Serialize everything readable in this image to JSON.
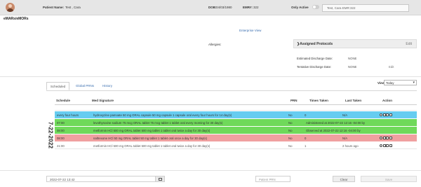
{
  "header": {
    "patient_label": "Patient Name:",
    "patient_name": "Test , Cara",
    "dob_label": "DOB:",
    "dob": "04/03/1980",
    "emr_label": "EMR#:",
    "emr": "322",
    "only_active_label": "Only Active",
    "patient_select_value": "Test, Cara EMR:322"
  },
  "module_title": "eMARs/eMORs",
  "enterprise_link": "Enterprise View",
  "allergies_label": "Allergies:",
  "protocols": {
    "title": "Assigned Protocols",
    "edit": "Edit"
  },
  "discharge": {
    "estimated_label": "Estimated Discharge Date:",
    "estimated_value": "NONE",
    "tentative_label": "Tentative Discharge Date:",
    "tentative_value": "NONE",
    "edit": "Edit"
  },
  "tabs": [
    "Scheduled",
    "Global PRNs",
    "History"
  ],
  "view": {
    "label": "View",
    "selected": "Today"
  },
  "table": {
    "headers": {
      "schedule": "Schedule",
      "med_signature": "Med Signature",
      "prn": "PRN",
      "times_taken": "Times Taken",
      "last_taken": "Last Taken",
      "action": "Action"
    },
    "date": "7-22-2022",
    "rows": [
      {
        "schedule": "every four hours",
        "med": "hydroxyzine pamoate 50 mg ORAL capsule 50 mg capsule 1 capsule oral every four hours for 14 day(s)",
        "prn": "No",
        "times_taken": "0",
        "last_taken": "N/A",
        "status": "blue"
      },
      {
        "schedule": "07:00",
        "med": "levothyroxine sodium 75 mcg ORAL tablet 75 mcg tablet 1 tablet oral every morning for 30 day(s)",
        "prn": "No",
        "times_taken": "Administered at 2022-07-22 12:16 -04:00 by",
        "last_taken": "",
        "status": "green"
      },
      {
        "schedule": "08:00",
        "med": "metformin HCl 500 mg ORAL tablet 500 mg tablet 1 tablet oral twice a day for 30 day(s)",
        "prn": "No",
        "times_taken": "Observed at 2022-07-22 12:16 -04:00 by",
        "last_taken": "",
        "status": "green"
      },
      {
        "schedule": "08:00",
        "med": "naltrexone HCl 50 mg ORAL tablet 50 mg tablet 1 tablet oral once a day for 30 day(s)",
        "prn": "No",
        "times_taken": "0",
        "last_taken": "N/A",
        "status": "red"
      },
      {
        "schedule": "21:00",
        "med": "metformin HCl 500 mg ORAL tablet 500 mg tablet 1 tablet oral twice a day for 30 day(s)",
        "prn": "No",
        "times_taken": "1",
        "last_taken": "2 hours ago",
        "status": "white"
      }
    ]
  },
  "footer": {
    "datetime_value": "2022-07-22 13:42",
    "prn_placeholder": "Patient PRN",
    "clear_label": "Clear",
    "save_label": "Save"
  },
  "colors": {
    "row_due": "#66ccf0",
    "row_done": "#6fd95a",
    "row_missed": "#f0a0a0",
    "link": "#3b6fb0"
  }
}
